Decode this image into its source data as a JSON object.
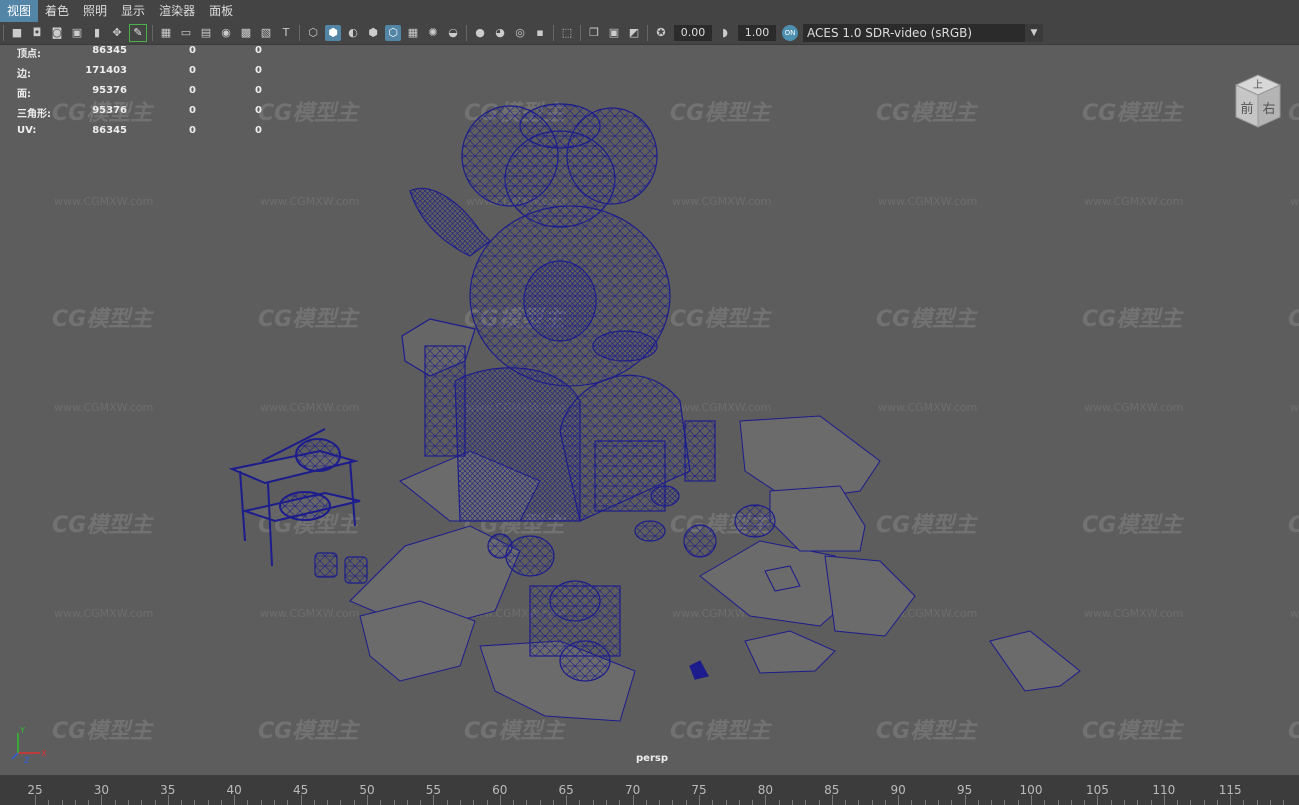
{
  "menu": {
    "items": [
      "视图",
      "着色",
      "照明",
      "显示",
      "渲染器",
      "面板"
    ],
    "active_index": 0
  },
  "toolbar": {
    "icons": [
      "camera-icon",
      "camera-attr-icon",
      "bookmark-camera-icon",
      "image-plane-icon",
      "bookmark-icon",
      "pan-zoom-icon",
      "grease-pencil-icon",
      "grid-icon",
      "film-gate-icon",
      "resolution-gate-icon",
      "gate-mask-icon",
      "field-chart-icon",
      "safe-title-icon",
      "wireframe-icon",
      "smooth-shade-icon",
      "use-default-material-icon",
      "wireframe-on-shaded-icon",
      "xray-icon",
      "textured-icon",
      "lights-icon",
      "shadows-icon",
      "screen-space-ao-icon",
      "motion-blur-icon",
      "multisample-aa-icon",
      "depth-of-field-icon",
      "isolate-select-icon",
      "xray-joints-icon",
      "xray-active-icon",
      "exposure-icon",
      "gamma-icon",
      "color-management-icon"
    ],
    "exposure_value": "0.00",
    "gamma_value": "1.00",
    "aces_badge": "ON",
    "color_space": "ACES 1.0 SDR-video (sRGB)"
  },
  "hud": {
    "rows": [
      {
        "label": "顶点:",
        "v1": "86345",
        "v2": "0",
        "v3": "0"
      },
      {
        "label": "边:",
        "v1": "171403",
        "v2": "0",
        "v3": "0"
      },
      {
        "label": "面:",
        "v1": "95376",
        "v2": "0",
        "v3": "0"
      },
      {
        "label": "三角形:",
        "v1": "95376",
        "v2": "0",
        "v3": "0"
      },
      {
        "label": "UV:",
        "v1": "86345",
        "v2": "0",
        "v3": "0"
      }
    ]
  },
  "watermark": {
    "logo": "CG模型主",
    "url": "www.CGMXW.com"
  },
  "viewcube": {
    "top": "上",
    "front": "前",
    "right": "右"
  },
  "viewport": {
    "camera_label": "persp",
    "wire_color": "#1c1c8c",
    "background_color": "#5d5d5d"
  },
  "axis": {
    "x": "X",
    "y": "Y",
    "z": "Z"
  },
  "timeline": {
    "ticks": [
      "25",
      "30",
      "35",
      "40",
      "45",
      "50",
      "55",
      "60",
      "65",
      "70",
      "75",
      "80",
      "85",
      "90",
      "95",
      "100",
      "105",
      "110",
      "115"
    ]
  }
}
